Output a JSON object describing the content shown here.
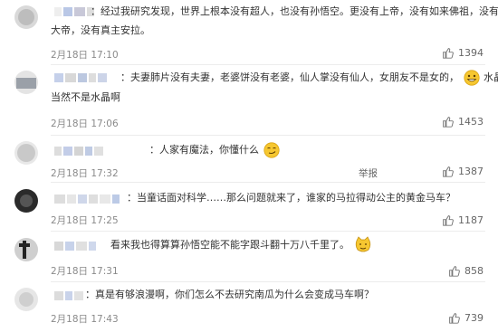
{
  "colors": {
    "text": "#333333",
    "meta": "#8a8a8a",
    "divider": "#ececec",
    "emoji_yellow": "#f6c731"
  },
  "comments": [
    {
      "text_line1": "：经过我研究发现，世界上根本没有超人，也没有孙悟空。更没有上帝，没有如来佛祖，没有玉皇",
      "text_line2": "大帝，没有真主安拉。",
      "time": "2月18日 17:10",
      "likes": "1394",
      "like_icon": "thumb-up-icon"
    },
    {
      "text_line1": "：夫妻肺片没有夫妻，老婆饼没有老婆，仙人掌没有仙人，女朋友不是女的，",
      "text_line1_tail": "水晶鞋",
      "text_line2": "当然不是水晶啊",
      "emoji": "grin-emoji",
      "time": "2月18日 17:06",
      "likes": "1453",
      "like_icon": "thumb-up-icon"
    },
    {
      "text_line1": "：人家有魔法，你懂什么",
      "emoji": "smirk-emoji",
      "time": "2月18日 17:32",
      "report": "举报",
      "likes": "1387",
      "like_icon": "thumb-up-icon"
    },
    {
      "text_line1": "：当童话面对科学……那么问题就来了，谁家的马拉得动公主的黄金马车？",
      "time": "2月18日 17:25",
      "likes": "1187",
      "like_icon": "thumb-up-icon"
    },
    {
      "text_line1": "看来我也得算算孙悟空能不能字跟斗翻十万八千里了。",
      "emoji": "cat-emoji",
      "time": "2月18日 17:31",
      "likes": "858",
      "like_icon": "thumb-up-icon"
    },
    {
      "text_line1": "：真是有够浪漫啊，你们怎么不去研究南瓜为什么会变成马车啊？",
      "time": "2月18日 17:43",
      "likes": "739",
      "like_icon": "thumb-up-icon"
    }
  ]
}
